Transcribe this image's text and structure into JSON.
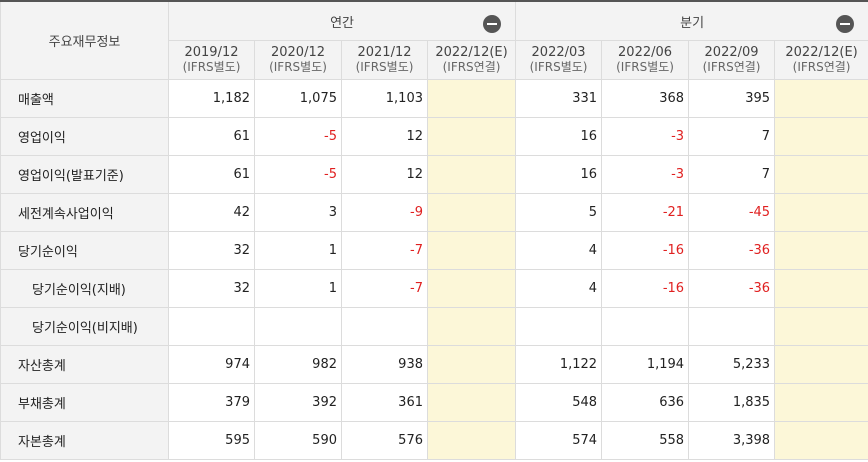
{
  "table_title": "주요재무정보",
  "groups": {
    "annual": "연간",
    "quarterly": "분기"
  },
  "periods": [
    {
      "date": "2019/12",
      "basis": "(IFRS별도)"
    },
    {
      "date": "2020/12",
      "basis": "(IFRS별도)"
    },
    {
      "date": "2021/12",
      "basis": "(IFRS별도)"
    },
    {
      "date": "2022/12(E)",
      "basis": "(IFRS연결)"
    },
    {
      "date": "2022/03",
      "basis": "(IFRS별도)"
    },
    {
      "date": "2022/06",
      "basis": "(IFRS별도)"
    },
    {
      "date": "2022/09",
      "basis": "(IFRS연결)"
    },
    {
      "date": "2022/12(E)",
      "basis": "(IFRS연결)"
    }
  ],
  "rows": [
    {
      "label": "매출액",
      "values": [
        "1,182",
        "1,075",
        "1,103",
        "",
        "331",
        "368",
        "395",
        ""
      ]
    },
    {
      "label": "영업이익",
      "values": [
        "61",
        "-5",
        "12",
        "",
        "16",
        "-3",
        "7",
        ""
      ]
    },
    {
      "label": "영업이익(발표기준)",
      "values": [
        "61",
        "-5",
        "12",
        "",
        "16",
        "-3",
        "7",
        ""
      ]
    },
    {
      "label": "세전계속사업이익",
      "values": [
        "42",
        "3",
        "-9",
        "",
        "5",
        "-21",
        "-45",
        ""
      ]
    },
    {
      "label": "당기순이익",
      "values": [
        "32",
        "1",
        "-7",
        "",
        "4",
        "-16",
        "-36",
        ""
      ]
    },
    {
      "label": "당기순이익(지배)",
      "values": [
        "32",
        "1",
        "-7",
        "",
        "4",
        "-16",
        "-36",
        ""
      ]
    },
    {
      "label": "당기순이익(비지배)",
      "values": [
        "",
        "",
        "",
        "",
        "",
        "",
        "",
        ""
      ]
    },
    {
      "label": "자산총계",
      "values": [
        "974",
        "982",
        "938",
        "",
        "1,122",
        "1,194",
        "5,233",
        ""
      ]
    },
    {
      "label": "부채총계",
      "values": [
        "379",
        "392",
        "361",
        "",
        "548",
        "636",
        "1,835",
        ""
      ]
    },
    {
      "label": "자본총계",
      "values": [
        "595",
        "590",
        "576",
        "",
        "574",
        "558",
        "3,398",
        ""
      ]
    }
  ],
  "colors": {
    "header_bg": "#f3f3f3",
    "estimate_bg": "#fcf7d8",
    "negative": "#e02020",
    "top_border": "#555555"
  }
}
